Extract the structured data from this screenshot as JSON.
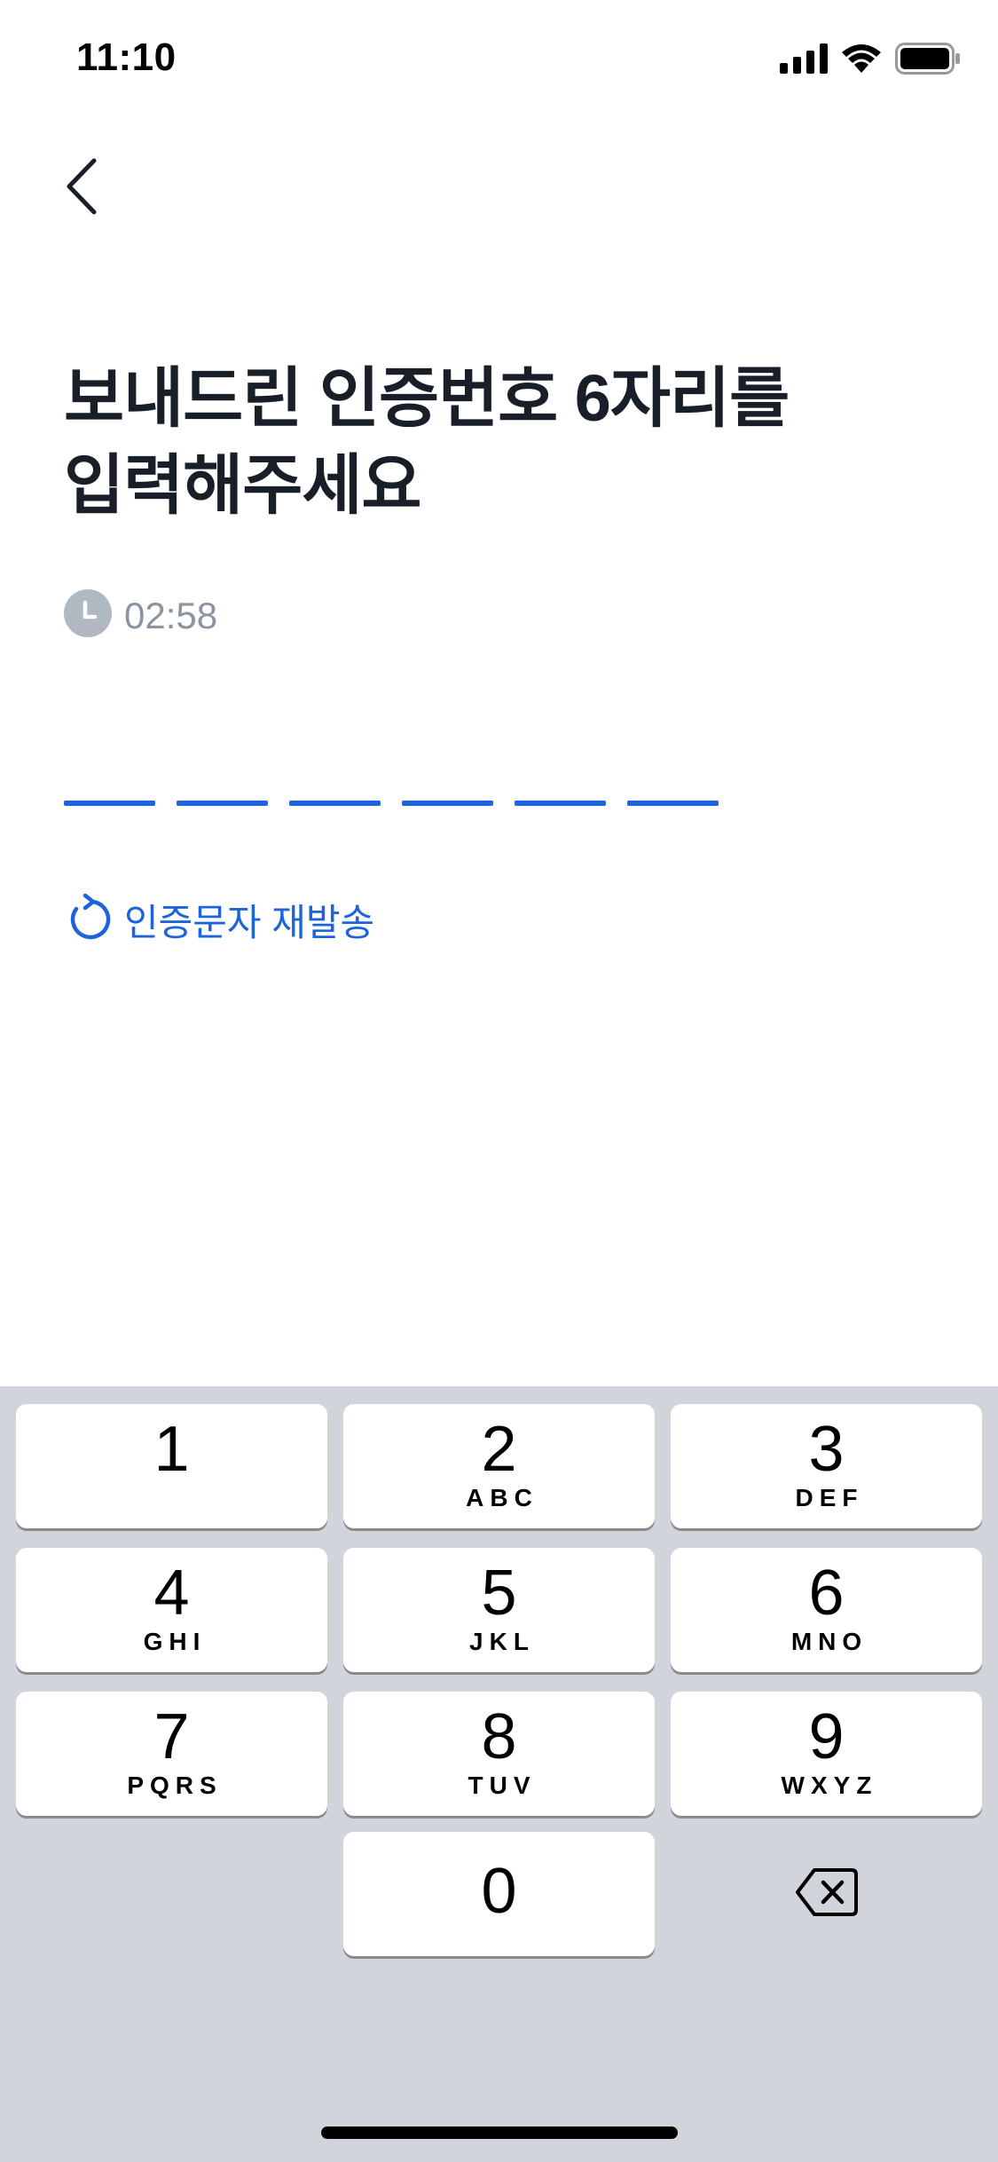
{
  "status_bar": {
    "time": "11:10",
    "icons": [
      "signal-icon",
      "wifi-icon",
      "battery-icon"
    ]
  },
  "nav": {
    "back_icon": "chevron-left-icon"
  },
  "title": {
    "line1": "보내드린 인증번호 6자리를",
    "line2": "입력해주세요"
  },
  "timer": {
    "icon": "clock-icon",
    "remaining": "02:58"
  },
  "code_input": {
    "length": 6,
    "entered": ""
  },
  "resend": {
    "icon": "refresh-icon",
    "label": "인증문자 재발송"
  },
  "keyboard": {
    "keys": [
      {
        "digit": "1",
        "letters": ""
      },
      {
        "digit": "2",
        "letters": "ABC"
      },
      {
        "digit": "3",
        "letters": "DEF"
      },
      {
        "digit": "4",
        "letters": "GHI"
      },
      {
        "digit": "5",
        "letters": "JKL"
      },
      {
        "digit": "6",
        "letters": "MNO"
      },
      {
        "digit": "7",
        "letters": "PQRS"
      },
      {
        "digit": "8",
        "letters": "TUV"
      },
      {
        "digit": "9",
        "letters": "WXYZ"
      },
      {
        "digit": "0",
        "letters": ""
      }
    ],
    "backspace_icon": "backspace-icon"
  },
  "colors": {
    "accent": "#1b64da",
    "title": "#191f28",
    "muted": "#8b95a1",
    "timer_icon": "#b0b8c1",
    "keyboard_bg": "#d1d4db"
  }
}
